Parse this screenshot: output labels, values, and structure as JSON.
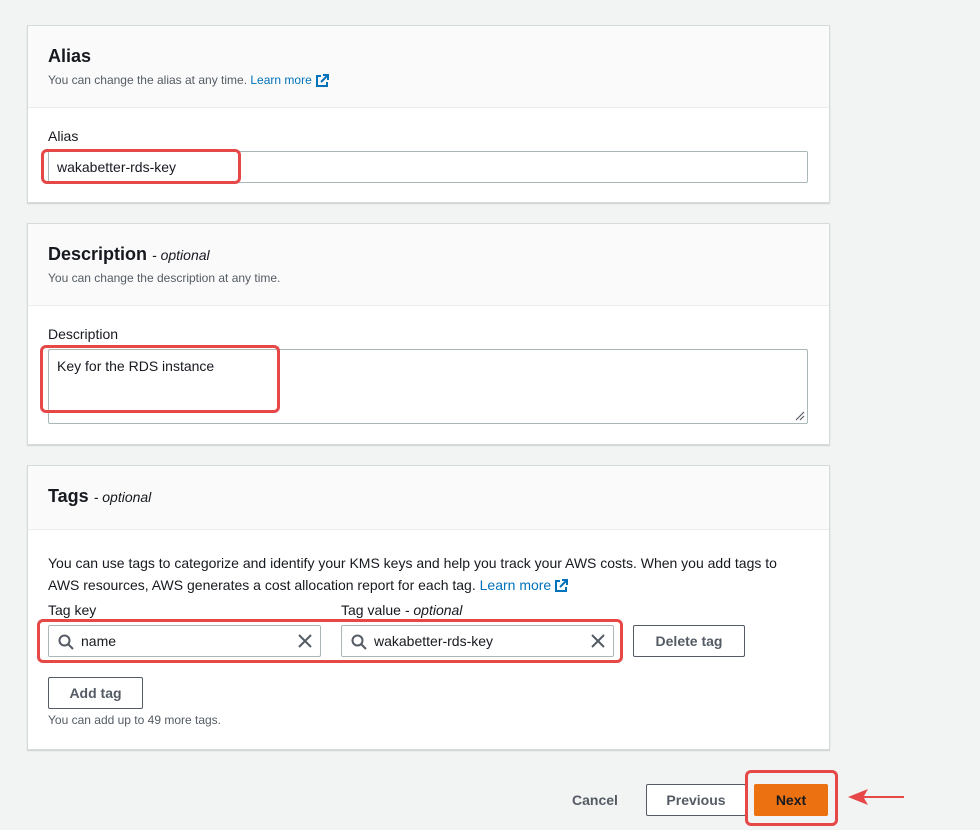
{
  "alias_panel": {
    "title": "Alias",
    "description": "You can change the alias at any time.",
    "learn_more": "Learn more",
    "field_label": "Alias",
    "value": "wakabetter-rds-key"
  },
  "description_panel": {
    "title": "Description",
    "optional": "- optional",
    "description": "You can change the description at any time.",
    "field_label": "Description",
    "value": "Key for the RDS instance"
  },
  "tags_panel": {
    "title": "Tags",
    "optional": "- optional",
    "info": "You can use tags to categorize and identify your KMS keys and help you track your AWS costs. When you add tags to AWS resources, AWS generates a cost allocation report for each tag.",
    "learn_more": "Learn more",
    "tag_key_label": "Tag key",
    "tag_value_label": "Tag value",
    "tag_value_optional": "- optional",
    "tag_key": "name",
    "tag_value": "wakabetter-rds-key",
    "delete_tag": "Delete tag",
    "add_tag": "Add tag",
    "limit_note": "You can add up to 49 more tags."
  },
  "footer": {
    "cancel": "Cancel",
    "previous": "Previous",
    "next": "Next"
  },
  "colors": {
    "primary": "#ec7211",
    "link": "#0073bb",
    "annotation": "#e64848"
  }
}
